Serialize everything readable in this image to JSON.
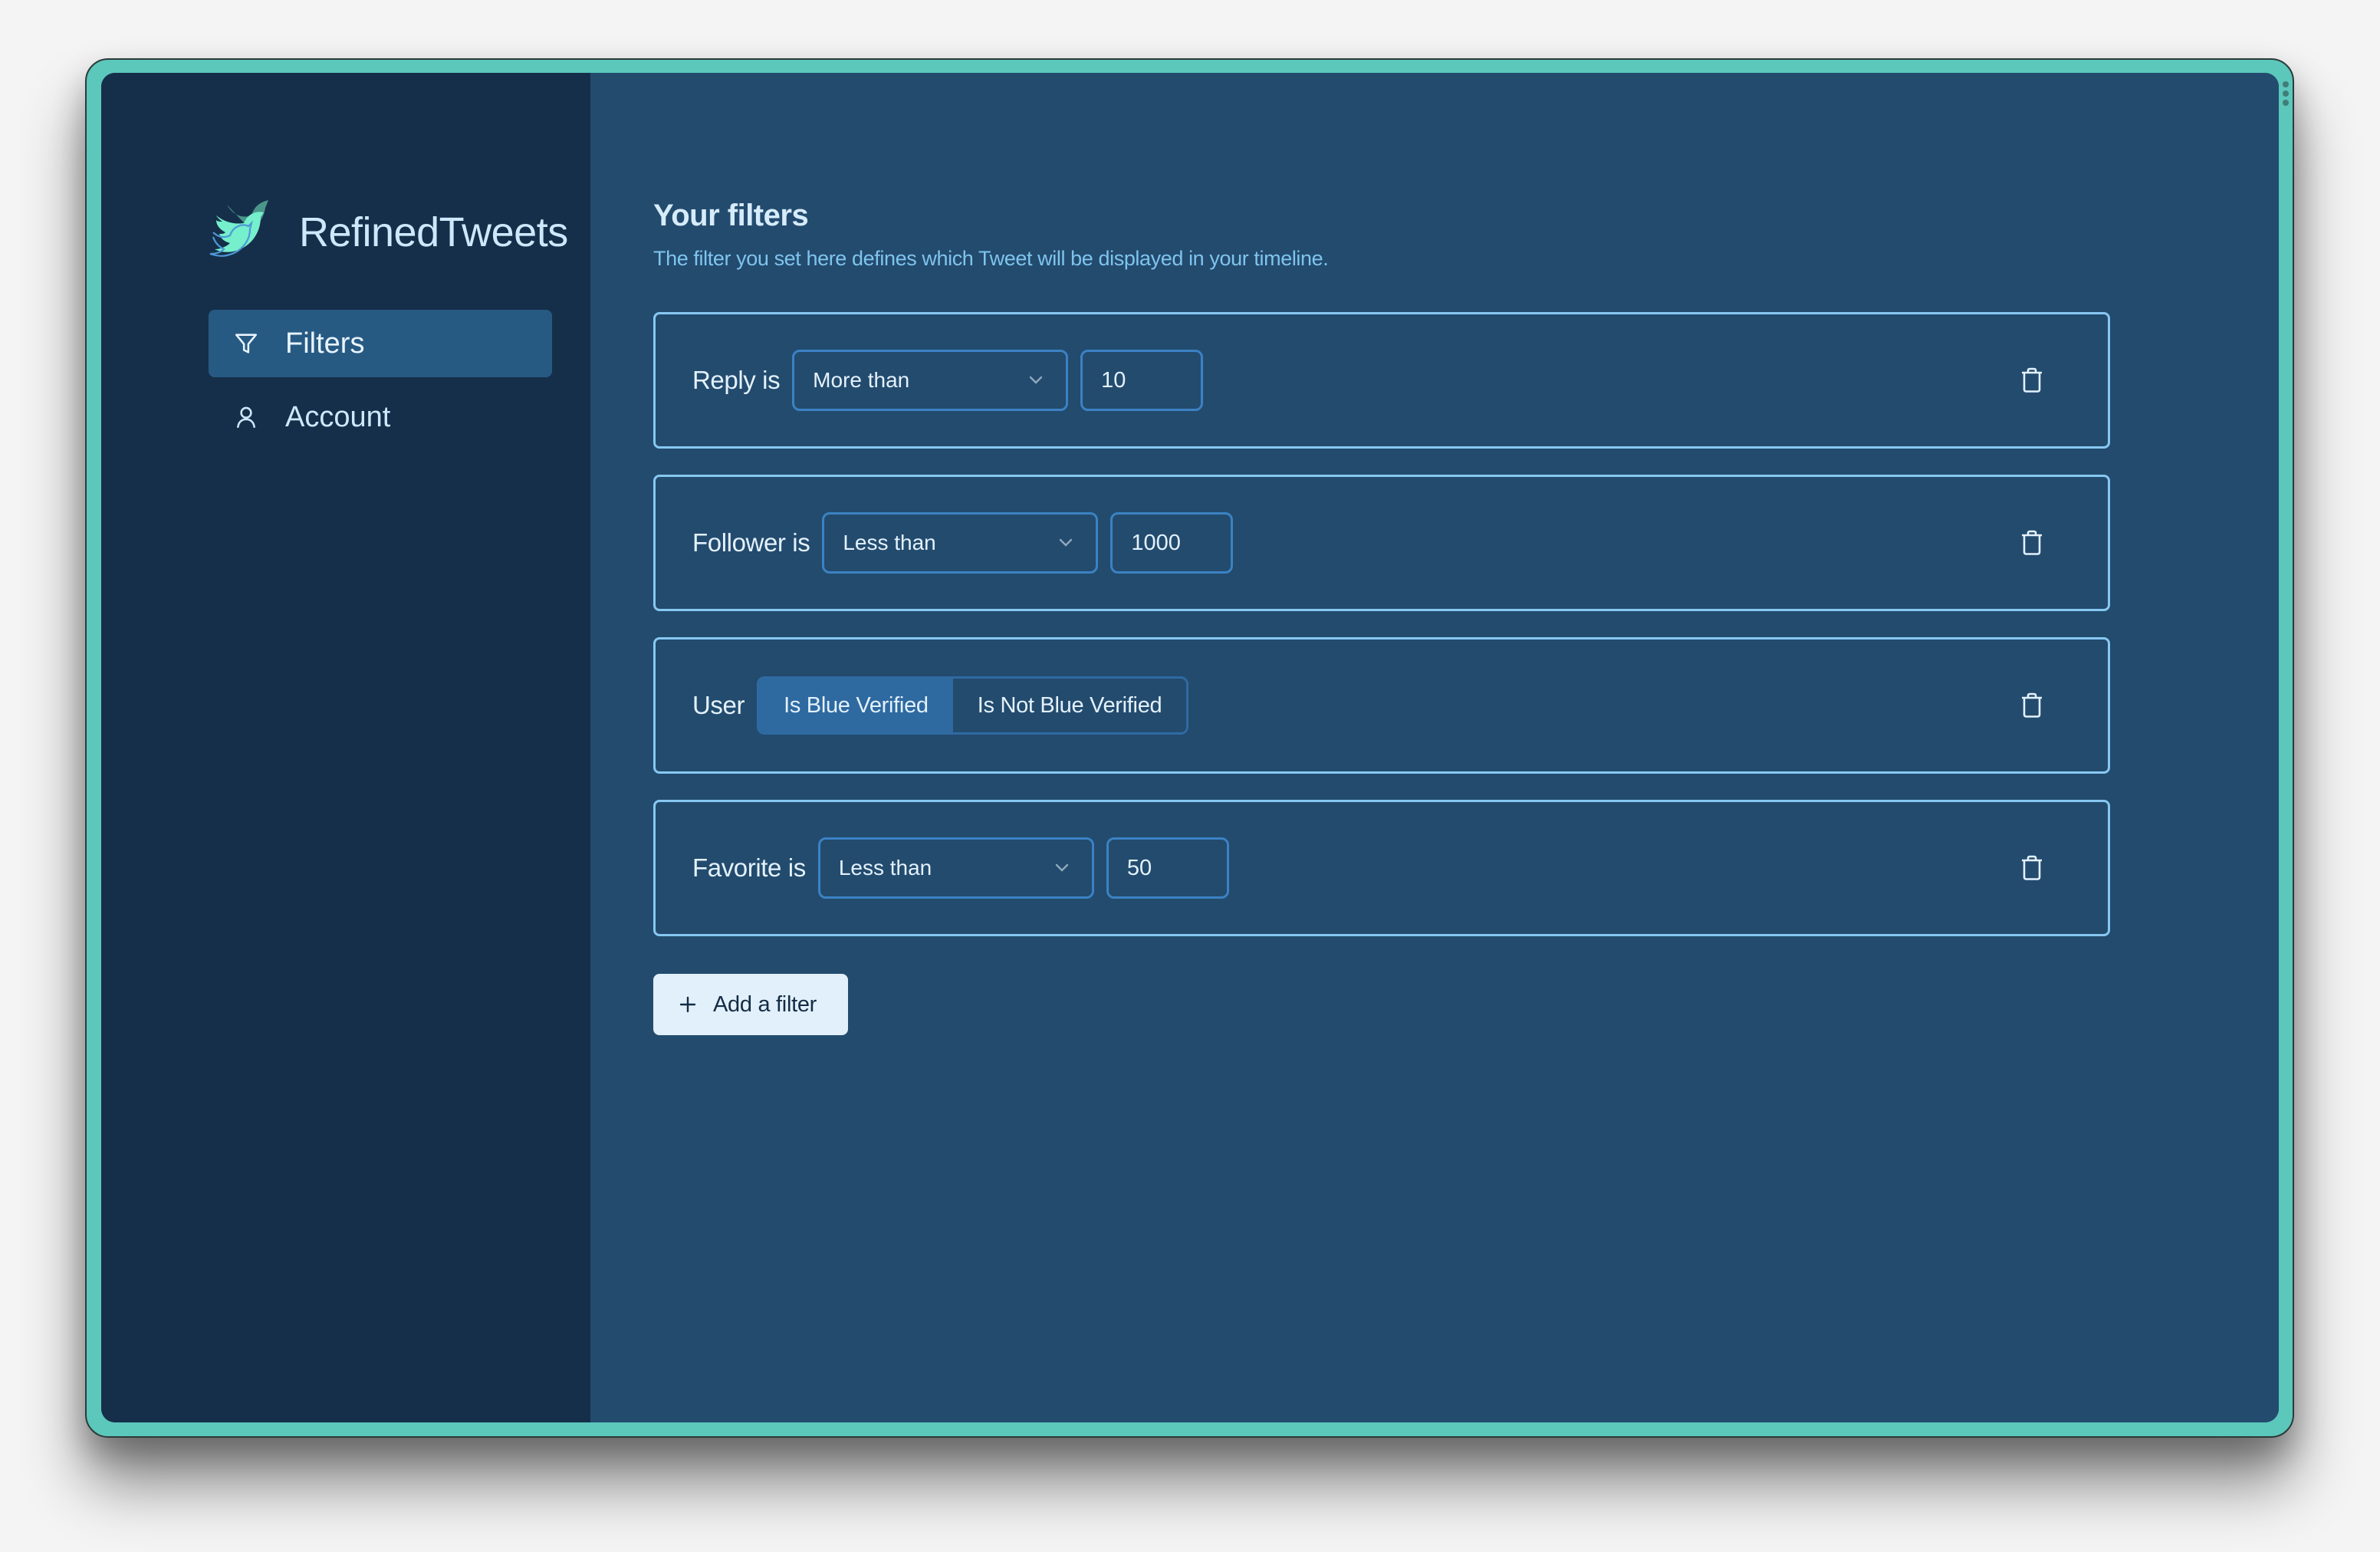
{
  "app": {
    "name": "RefinedTweets",
    "logo_icon": "twitter-bird-logo"
  },
  "colors": {
    "frame": "#5cc7bb",
    "sidebar_bg": "#152f4a",
    "main_bg": "#234b6e",
    "nav_active_bg": "#275a83",
    "card_border": "#86c8f2",
    "input_border": "#3b82c4",
    "segment_active": "#2e69a0",
    "subtitle": "#7fc4ee",
    "add_button_bg": "#e2f0fb"
  },
  "sidebar": {
    "items": [
      {
        "label": "Filters",
        "icon": "filter-icon",
        "active": true
      },
      {
        "label": "Account",
        "icon": "user-icon",
        "active": false
      }
    ]
  },
  "main": {
    "title": "Your filters",
    "subtitle": "The filter you set here defines which Tweet will be displayed in your timeline.",
    "filters": [
      {
        "label": "Reply is",
        "operator": "More than",
        "value": "10"
      },
      {
        "label": "Follower is",
        "operator": "Less than",
        "value": "1000"
      },
      {
        "label": "User",
        "options": [
          "Is Blue Verified",
          "Is Not Blue Verified"
        ],
        "selected": "Is Blue Verified"
      },
      {
        "label": "Favorite is",
        "operator": "Less than",
        "value": "50"
      }
    ],
    "add_button_label": "Add a filter"
  }
}
